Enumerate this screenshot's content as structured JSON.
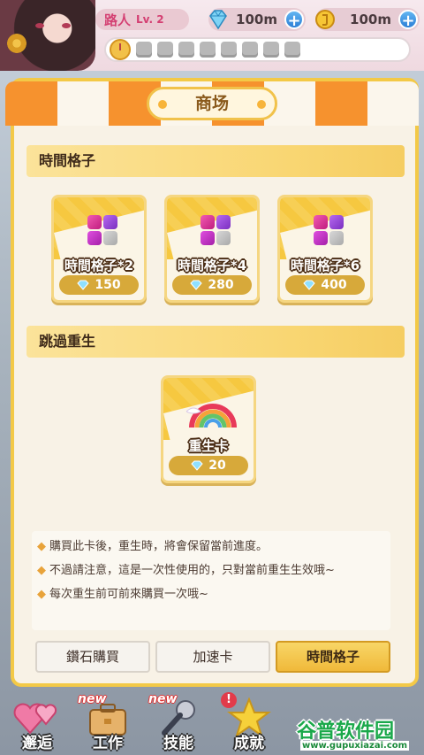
{
  "header": {
    "player_name": "路人",
    "level": "Lv. 2",
    "diamonds": "100m",
    "coins": "100m",
    "plus_label": "+"
  },
  "shop": {
    "title": "商场",
    "sections": [
      {
        "title": "時間格子",
        "items": [
          {
            "label": "時間格子*2",
            "price": "150"
          },
          {
            "label": "時間格子*4",
            "price": "280"
          },
          {
            "label": "時間格子*6",
            "price": "400"
          }
        ]
      },
      {
        "title": "跳過重生",
        "items": [
          {
            "label": "重生卡",
            "price": "20"
          }
        ]
      }
    ],
    "notes": [
      "購買此卡後，重生時，將會保留當前進度。",
      "不過請注意，這是一次性使用的，只對當前重生生效哦~",
      "每次重生前可前來購買一次哦~"
    ],
    "note_bullet": "◆",
    "tabs": [
      "鑽石購買",
      "加速卡",
      "時間格子"
    ],
    "active_tab": "時間格子"
  },
  "bottom_nav": {
    "items": [
      {
        "label": "邂逅",
        "badge": ""
      },
      {
        "label": "工作",
        "badge": "new"
      },
      {
        "label": "技能",
        "badge": "new"
      },
      {
        "label": "成就",
        "badge": "!"
      }
    ]
  },
  "watermark": {
    "text": "谷普软件园",
    "url": "www.gupuxiazai.com"
  },
  "colors": {
    "accent_orange": "#f6922e",
    "gold": "#f3c947",
    "price_pill": "#d7a93a",
    "pink_name": "#d43f72"
  }
}
